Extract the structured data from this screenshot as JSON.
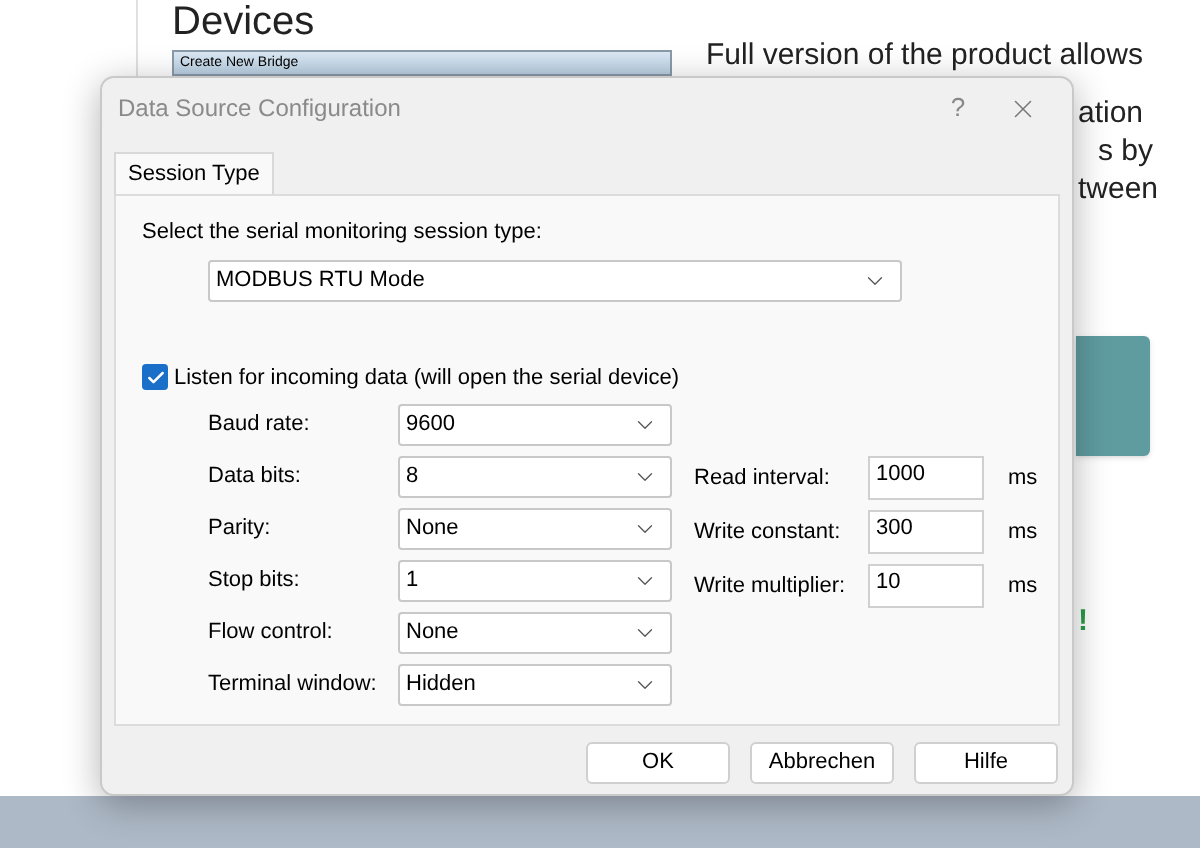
{
  "background": {
    "heading": "Devices",
    "thumbnail_title": "Create New Bridge",
    "paragraph_lines": [
      "Full version of the product allows",
      "ation",
      "s by",
      "tween"
    ],
    "mark": "!"
  },
  "dialog": {
    "title": "Data Source Configuration",
    "help": "?",
    "tabs": [
      {
        "label": "Session Type",
        "selected": true
      }
    ],
    "session_label": "Select the serial monitoring session type:",
    "session_value": "MODBUS RTU Mode",
    "listen": {
      "label": "Listen for incoming data (will open the serial device)",
      "checked": true
    },
    "left_fields": [
      {
        "label": "Baud rate:",
        "value": "9600"
      },
      {
        "label": "Data bits:",
        "value": "8"
      },
      {
        "label": "Parity:",
        "value": "None"
      },
      {
        "label": "Stop bits:",
        "value": "1"
      },
      {
        "label": "Flow control:",
        "value": "None"
      },
      {
        "label": "Terminal window:",
        "value": "Hidden"
      }
    ],
    "right_fields": [
      {
        "label": "Read interval:",
        "value": "1000",
        "unit": "ms"
      },
      {
        "label": "Write constant:",
        "value": "300",
        "unit": "ms"
      },
      {
        "label": "Write multiplier:",
        "value": "10",
        "unit": "ms"
      }
    ],
    "buttons": [
      "OK",
      "Abbrechen",
      "Hilfe"
    ]
  }
}
